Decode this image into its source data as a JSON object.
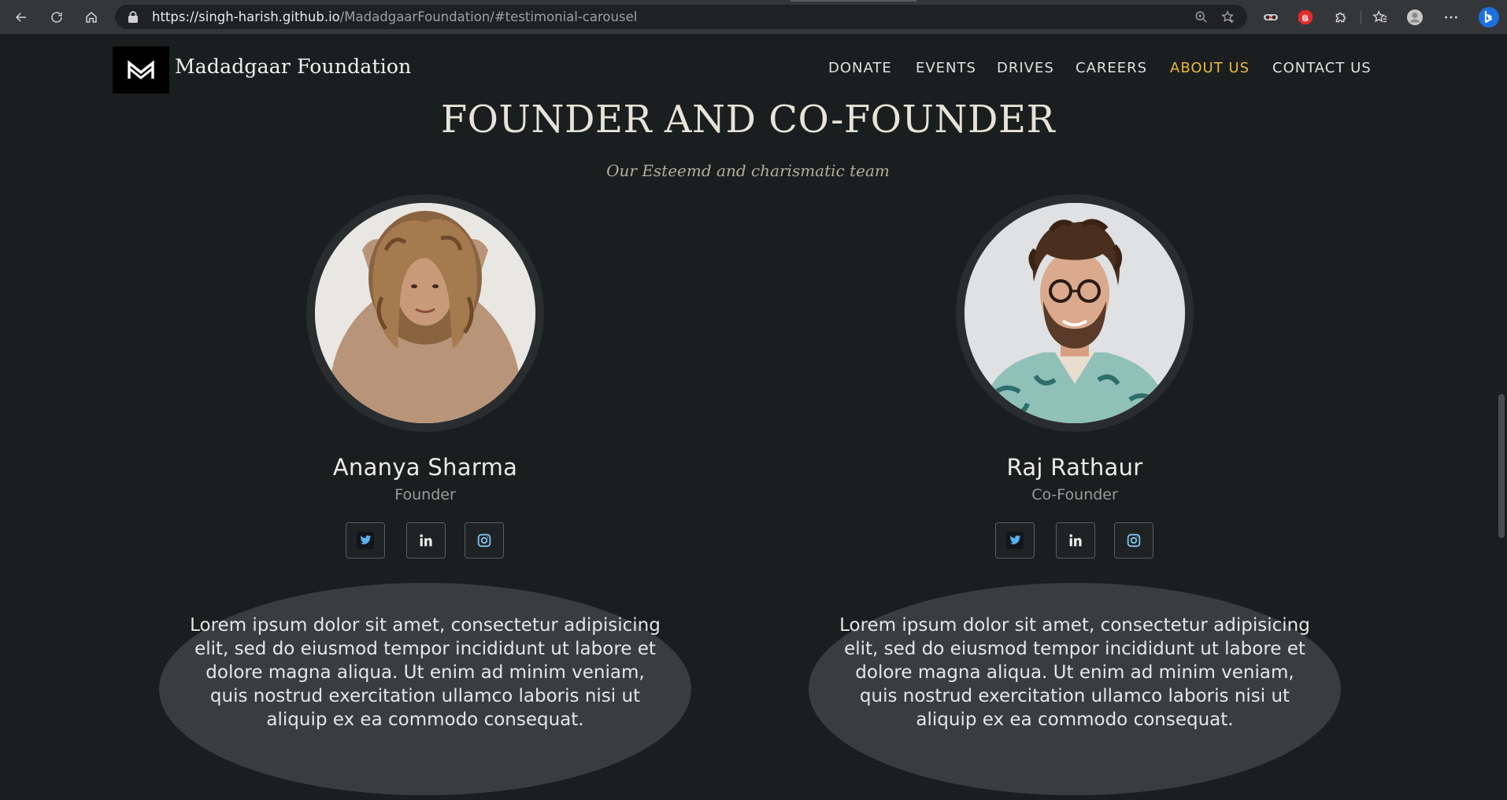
{
  "browser": {
    "url_host": "https://singh-harish.github.io",
    "url_path": "/MadadgaarFoundation/#testimonial-carousel"
  },
  "site": {
    "brand_name": "Madadgaar Foundation",
    "nav": [
      {
        "label": "DONATE"
      },
      {
        "label": "EVENTS"
      },
      {
        "label": "DRIVES"
      },
      {
        "label": "CAREERS"
      },
      {
        "label": "ABOUT US",
        "active": true
      },
      {
        "label": "CONTACT US"
      }
    ],
    "accent_color": "#e7b93c"
  },
  "section": {
    "title": "FOUNDER AND CO-FOUNDER",
    "subtitle": "Our Esteemd and charismatic team"
  },
  "team": [
    {
      "name": "Ananya Sharma",
      "role": "Founder",
      "socials": [
        "twitter-icon",
        "linkedin-icon",
        "instagram-icon"
      ],
      "bio": "Lorem ipsum dolor sit amet, consectetur adipisicing elit, sed do eiusmod tempor incididunt ut labore et dolore magna aliqua. Ut enim ad minim veniam, quis nostrud exercitation ullamco laboris nisi ut aliquip ex ea commodo consequat."
    },
    {
      "name": "Raj Rathaur",
      "role": "Co-Founder",
      "socials": [
        "twitter-icon",
        "linkedin-icon",
        "instagram-icon"
      ],
      "bio": "Lorem ipsum dolor sit amet, consectetur adipisicing elit, sed do eiusmod tempor incididunt ut labore et dolore magna aliqua. Ut enim ad minim veniam, quis nostrud exercitation ullamco laboris nisi ut aliquip ex ea commodo consequat."
    }
  ]
}
